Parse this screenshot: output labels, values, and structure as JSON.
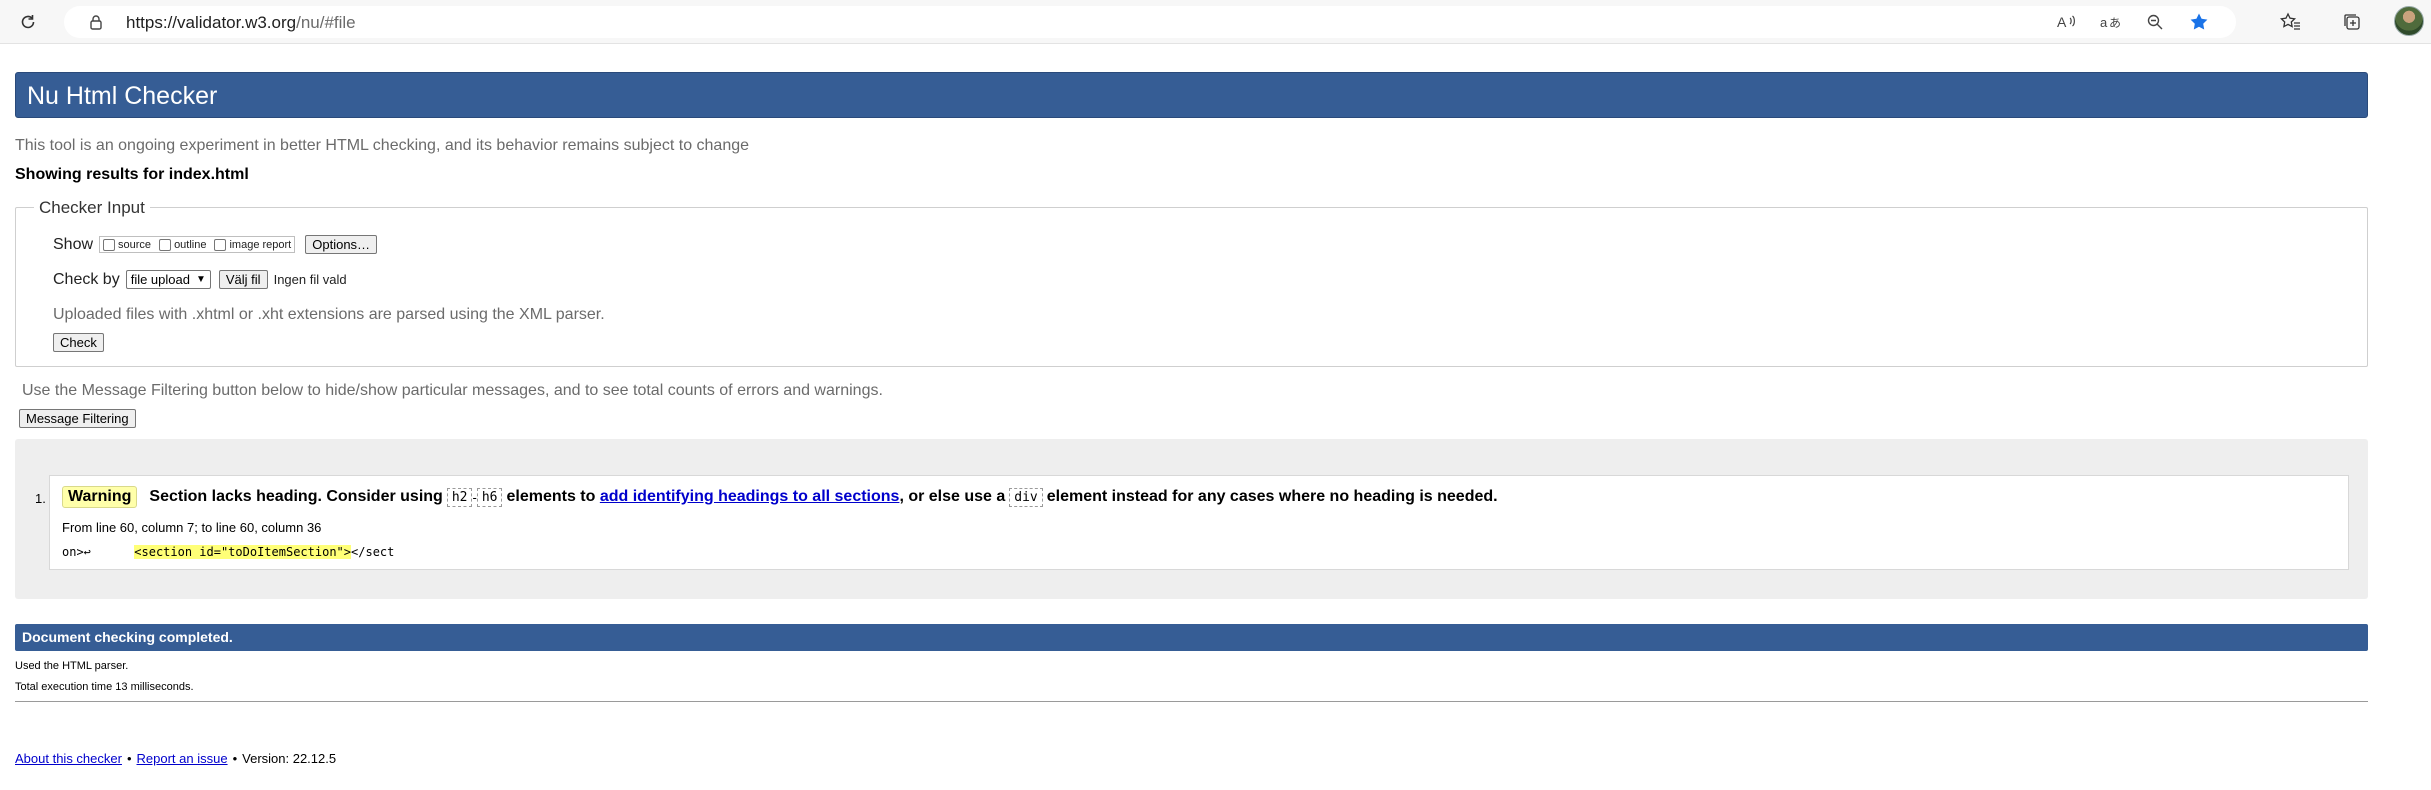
{
  "browser": {
    "url_domain": "https://validator.w3.org",
    "url_path": "/nu/#file",
    "tools": [
      "read-aloud-icon",
      "translate-icon",
      "zoom-icon"
    ]
  },
  "header": {
    "title": "Nu Html Checker"
  },
  "intro_text": "This tool is an ongoing experiment in better HTML checking, and its behavior remains subject to change",
  "showing_results": "Showing results for index.html",
  "checker_input": {
    "legend": "Checker Input",
    "show_label": "Show",
    "options": [
      {
        "label": "source",
        "checked": false
      },
      {
        "label": "outline",
        "checked": false
      },
      {
        "label": "image report",
        "checked": false
      }
    ],
    "options_button": "Options…",
    "check_by_label": "Check by",
    "check_by_value": "file upload",
    "choose_file_button": "Välj fil",
    "no_file_text": "Ingen fil vald",
    "upload_note": "Uploaded files with .xhtml or .xht extensions are parsed using the XML parser.",
    "check_button": "Check"
  },
  "filter_note": "Use the Message Filtering button below to hide/show particular messages, and to see total counts of errors and warnings.",
  "filter_button": "Message Filtering",
  "messages": [
    {
      "number": "1.",
      "type": "Warning",
      "text_before": "Section lacks heading. Consider using",
      "code_h2": "h2",
      "dash": "-",
      "code_h6": "h6",
      "text_mid": "elements to",
      "link_text": "add identifying headings to all sections",
      "text_after": ", or else use a",
      "code_div": "div",
      "text_end": "element instead for any cases where no heading is needed.",
      "location": "From line 60, column 7; to line 60, column 36",
      "extract_prefix": "on>↩",
      "extract_spacing": "      ",
      "extract_highlight": "<section id=\"toDoItemSection\">",
      "extract_suffix": "</sect"
    }
  ],
  "completed": {
    "title": "Document checking completed.",
    "parser_note": "Used the HTML parser.",
    "exec_note": "Total execution time 13 milliseconds."
  },
  "footer": {
    "about_link": "About this checker",
    "bullet": "•",
    "report_link": "Report an issue",
    "version": "Version: 22.12.5"
  },
  "colors": {
    "header_blue": "#365d95",
    "warning_badge": "#ffffaa",
    "highlight": "#ffff77",
    "link": "#0000cc"
  }
}
